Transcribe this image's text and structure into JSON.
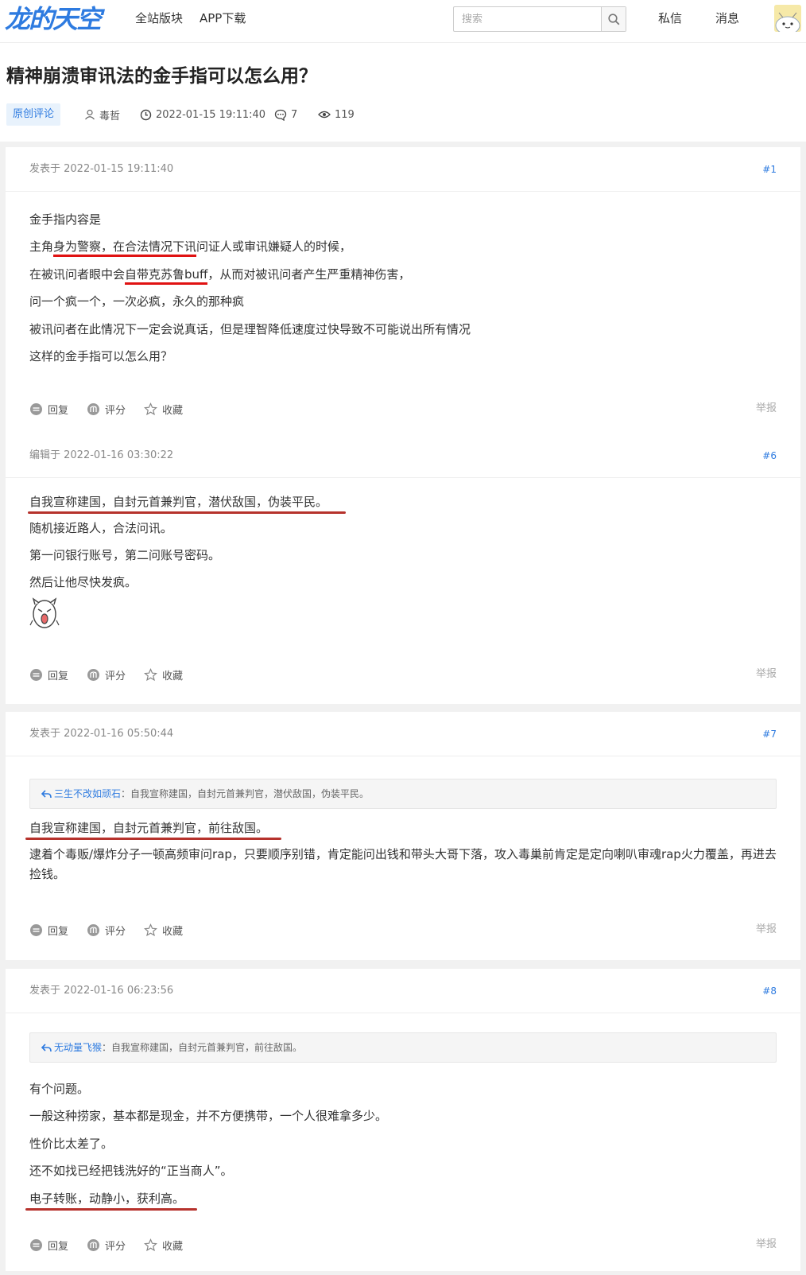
{
  "header": {
    "logo": "龙的天空",
    "nav": [
      "全站版块",
      "APP下载"
    ],
    "search_placeholder": "搜索",
    "messages": "私信",
    "notifications": "消息"
  },
  "thread": {
    "title": "精神崩溃审讯法的金手指可以怎么用？",
    "tag": "原创评论",
    "author": "毒哲",
    "datetime": "2022-01-15 19:11:40",
    "replies": "7",
    "views": "119"
  },
  "labels": {
    "reply": "回复",
    "rate": "评分",
    "favorite": "收藏",
    "report": "举报"
  },
  "posts": [
    {
      "time": "发表于 2022-01-15 19:11:40",
      "floor": "#1",
      "lines": [
        "金手指内容是",
        "主角",
        "身为警察，在合法情况下讯",
        "问证人或审讯嫌疑人的时候，",
        "在被讯问者眼中会",
        "自带克苏鲁buff",
        "，从而对被讯问者产生严重精神伤害，",
        "问一个疯一个，一次必疯，永久的那种疯",
        "被讯问者在此情况下一定会说真话，但是理智降低速度过快导致不可能说出所有情况",
        "这样的金手指可以怎么用？"
      ]
    },
    {
      "time": "编辑于 2022-01-16 03:30:22",
      "floor": "#6",
      "lines": [
        "自我宣称建国，自封元首兼判官，潜伏敌国，伪装平民。",
        "随机接近路人，合法问讯。",
        "第一问银行账号，第二问账号密码。",
        "然后让他尽快发疯。"
      ]
    },
    {
      "time": "发表于 2022-01-16 05:50:44",
      "floor": "#7",
      "quote_name": "三生不改如顽石",
      "quote_text": "：自我宣称建国，自封元首兼判官，潜伏敌国，伪装平民。",
      "lines": [
        "自我宣称建国，自封元首兼判官，前往敌国。",
        "逮着个毒贩/爆炸分子一顿高频审问rap，只要顺序别错，肯定能问出钱和带头大哥下落，攻入毒巢前肯定是定向喇叭审魂rap火力覆盖，再进去捡钱。"
      ]
    },
    {
      "time": "发表于 2022-01-16 06:23:56",
      "floor": "#8",
      "quote_name": "无动量飞猴",
      "quote_text": "：自我宣称建国，自封元首兼判官，前往敌国。",
      "lines": [
        "有个问题。",
        "一般这种捞家，基本都是现金，并不方便携带，一个人很难拿多少。",
        "性价比太差了。",
        "还不如找已经把钱洗好的“正当商人”。",
        "电子转账，动静小，获利高。"
      ]
    }
  ],
  "colors": {
    "accent": "#2e7be0",
    "underline_red": "#e01212",
    "underline_dark": "#b6322c"
  }
}
